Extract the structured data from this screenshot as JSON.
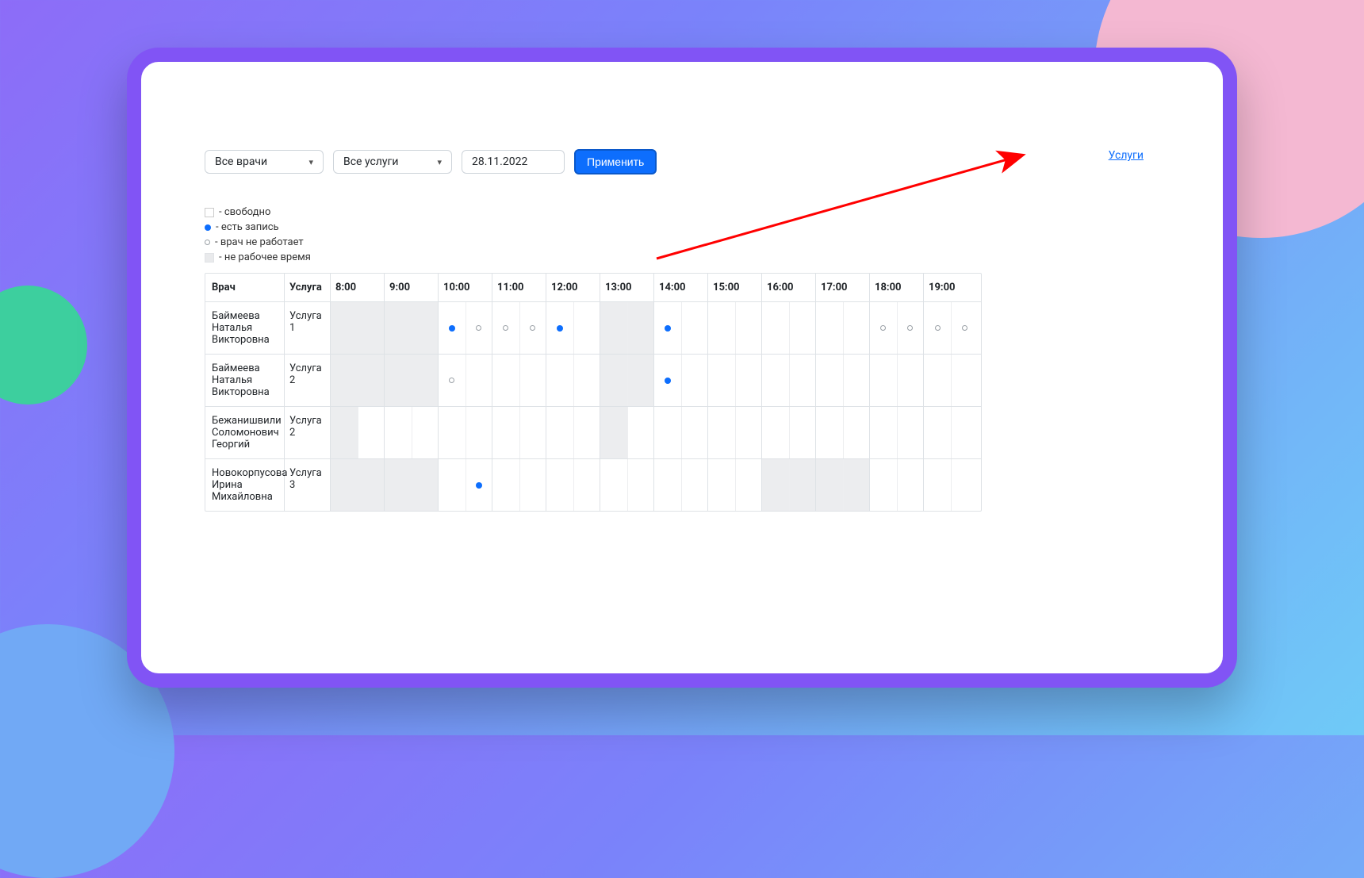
{
  "filters": {
    "doctors_label": "Все врачи",
    "services_label": "Все услуги",
    "date_value": "28.11.2022",
    "apply_label": "Применить"
  },
  "services_link": "Услуги",
  "legend": {
    "free": "- свободно",
    "booked": "- есть запись",
    "doctor_off": "- врач не работает",
    "nonworking": "- не рабочее время"
  },
  "columns": {
    "doctor": "Врач",
    "service": "Услуга",
    "hours": [
      "8:00",
      "9:00",
      "10:00",
      "11:00",
      "12:00",
      "13:00",
      "14:00",
      "15:00",
      "16:00",
      "17:00",
      "18:00",
      "19:00"
    ]
  },
  "rows": [
    {
      "doctor": "Баймеева Наталья Викторовна",
      "service": "Услуга 1",
      "slots": [
        "nw",
        "nw",
        "nw",
        "nw",
        "full",
        "off",
        "off",
        "off",
        "full",
        "",
        "nw",
        "nw",
        "full",
        "",
        "",
        "",
        "",
        "",
        "",
        "",
        "off",
        "off",
        "off",
        "off"
      ]
    },
    {
      "doctor": "Баймеева Наталья Викторовна",
      "service": "Услуга 2",
      "slots": [
        "nw",
        "nw",
        "nw",
        "nw",
        "off",
        "",
        "",
        "",
        "",
        "",
        "nw",
        "nw",
        "full",
        "",
        "",
        "",
        "",
        "",
        "",
        "",
        "",
        "",
        "",
        ""
      ]
    },
    {
      "doctor": "Бежанишвили Соломонович Георгий",
      "service": "Услуга 2",
      "slots": [
        "nw",
        "",
        "",
        "",
        "",
        "",
        "",
        "",
        "",
        "",
        "nw",
        "",
        "",
        "",
        "",
        "",
        "",
        "",
        "",
        "",
        "",
        "",
        "",
        ""
      ]
    },
    {
      "doctor": "Новокорпусова Ирина Михайловна",
      "service": "Услуга 3",
      "slots": [
        "nw",
        "nw",
        "nw",
        "nw",
        "",
        "full",
        "",
        "",
        "",
        "",
        "",
        "",
        "",
        "",
        "",
        "",
        "nw",
        "nw",
        "nw",
        "nw",
        "",
        "",
        "",
        ""
      ]
    }
  ]
}
